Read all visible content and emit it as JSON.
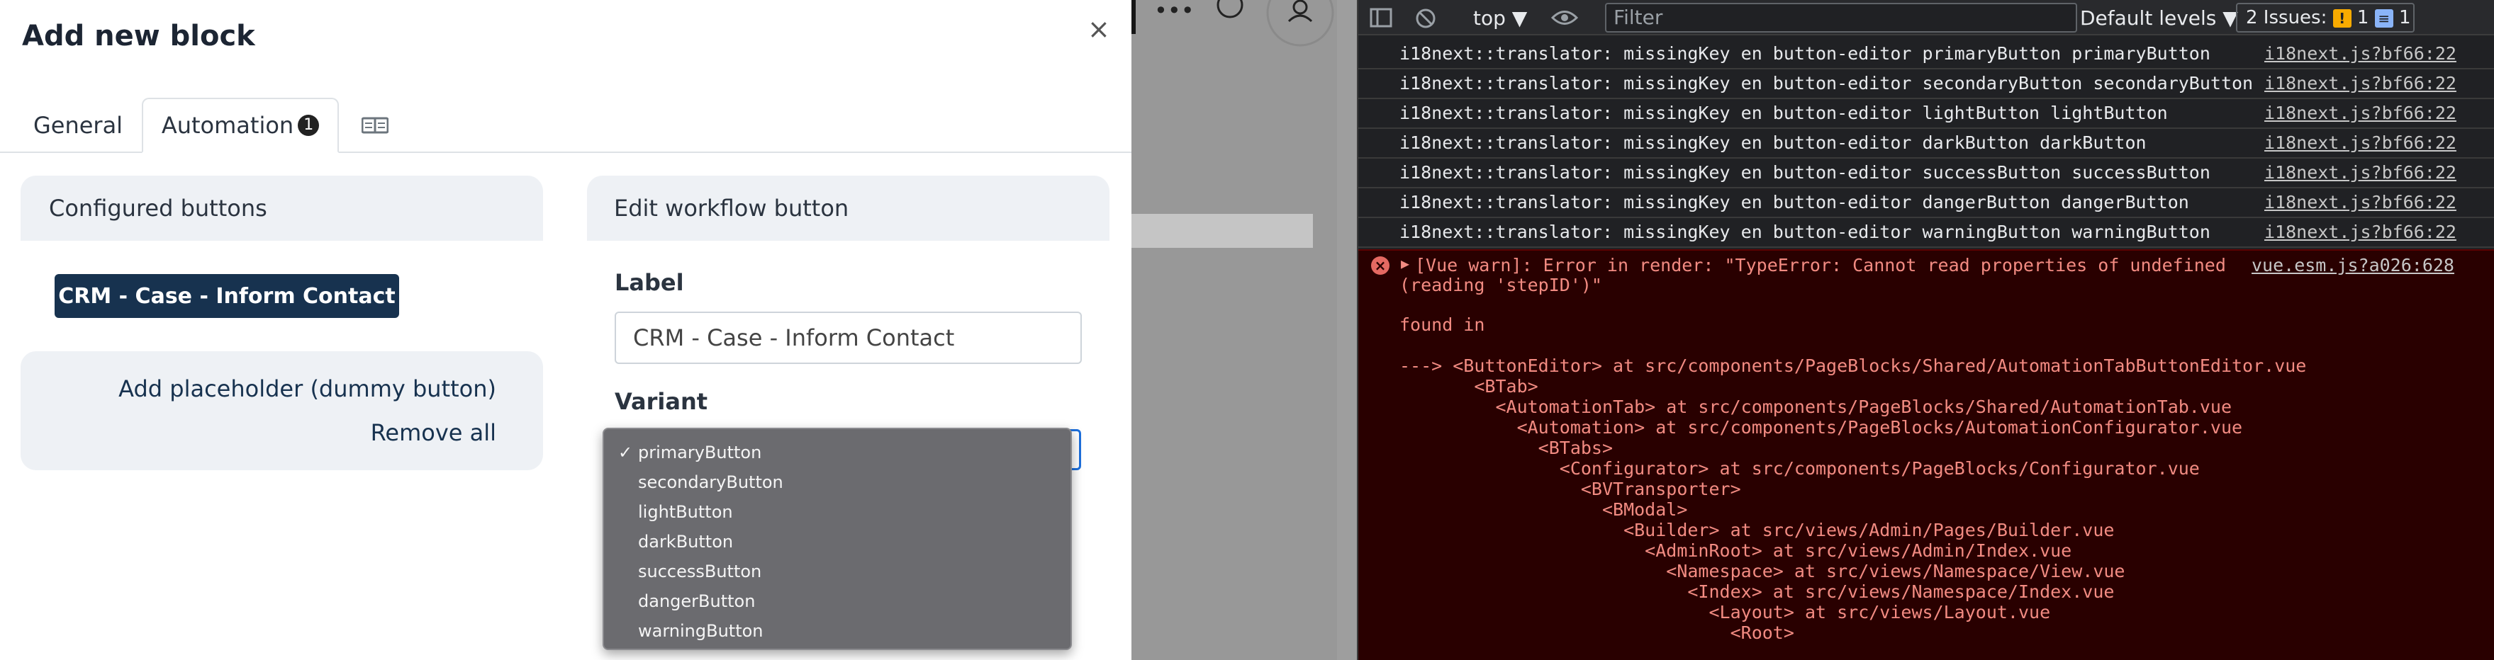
{
  "modal": {
    "title": "Add new block",
    "close": "×",
    "tabs": {
      "general": "General",
      "automation": "Automation",
      "automation_badge": "1",
      "third_icon": "columns-icon"
    },
    "configured_panel": {
      "header": "Configured buttons",
      "button": "CRM - Case - Inform Contact",
      "add_placeholder": "Add placeholder (dummy button)",
      "remove_all": "Remove all"
    },
    "edit_panel": {
      "header": "Edit workflow button",
      "label_title": "Label",
      "label_value": "CRM - Case - Inform Contact",
      "variant_title": "Variant",
      "variant_options": [
        "primaryButton",
        "secondaryButton",
        "lightButton",
        "darkButton",
        "successButton",
        "dangerButton",
        "warningButton"
      ],
      "variant_selected": "primaryButton",
      "check": "✓"
    }
  },
  "background": {
    "icons": {
      "more": "•••",
      "help": "?",
      "user": "user-icon"
    }
  },
  "devtools": {
    "toolbar": {
      "context": "top",
      "filter_placeholder": "Filter",
      "levels": "Default levels",
      "issues_label": "2 Issues:",
      "warn_count": "1",
      "info_count": "1"
    },
    "logs": [
      {
        "msg": "i18next::translator: missingKey en button-editor primaryButton primaryButton",
        "src": "i18next.js?bf66:22"
      },
      {
        "msg": "i18next::translator: missingKey en button-editor secondaryButton secondaryButton",
        "src": "i18next.js?bf66:22"
      },
      {
        "msg": "i18next::translator: missingKey en button-editor lightButton lightButton",
        "src": "i18next.js?bf66:22"
      },
      {
        "msg": "i18next::translator: missingKey en button-editor darkButton darkButton",
        "src": "i18next.js?bf66:22"
      },
      {
        "msg": "i18next::translator: missingKey en button-editor successButton successButton",
        "src": "i18next.js?bf66:22"
      },
      {
        "msg": "i18next::translator: missingKey en button-editor dangerButton dangerButton",
        "src": "i18next.js?bf66:22"
      },
      {
        "msg": "i18next::translator: missingKey en button-editor warningButton warningButton",
        "src": "i18next.js?bf66:22"
      }
    ],
    "error": {
      "line1": "[Vue warn]: Error in render: \"TypeError: Cannot read properties of undefined",
      "line2": "(reading 'stepID')\"",
      "src": "vue.esm.js?a026:628",
      "found_in": "found in",
      "trace": [
        "---> <ButtonEditor> at src/components/PageBlocks/Shared/AutomationTabButtonEditor.vue",
        "       <BTab>",
        "         <AutomationTab> at src/components/PageBlocks/Shared/AutomationTab.vue",
        "           <Automation> at src/components/PageBlocks/AutomationConfigurator.vue",
        "             <BTabs>",
        "               <Configurator> at src/components/PageBlocks/Configurator.vue",
        "                 <BVTransporter>",
        "                   <BModal>",
        "                     <Builder> at src/views/Admin/Pages/Builder.vue",
        "                       <AdminRoot> at src/views/Admin/Index.vue",
        "                         <Namespace> at src/views/Namespace/View.vue",
        "                           <Index> at src/views/Namespace/Index.vue",
        "                             <Layout> at src/views/Layout.vue",
        "                               <Root>"
      ]
    }
  }
}
